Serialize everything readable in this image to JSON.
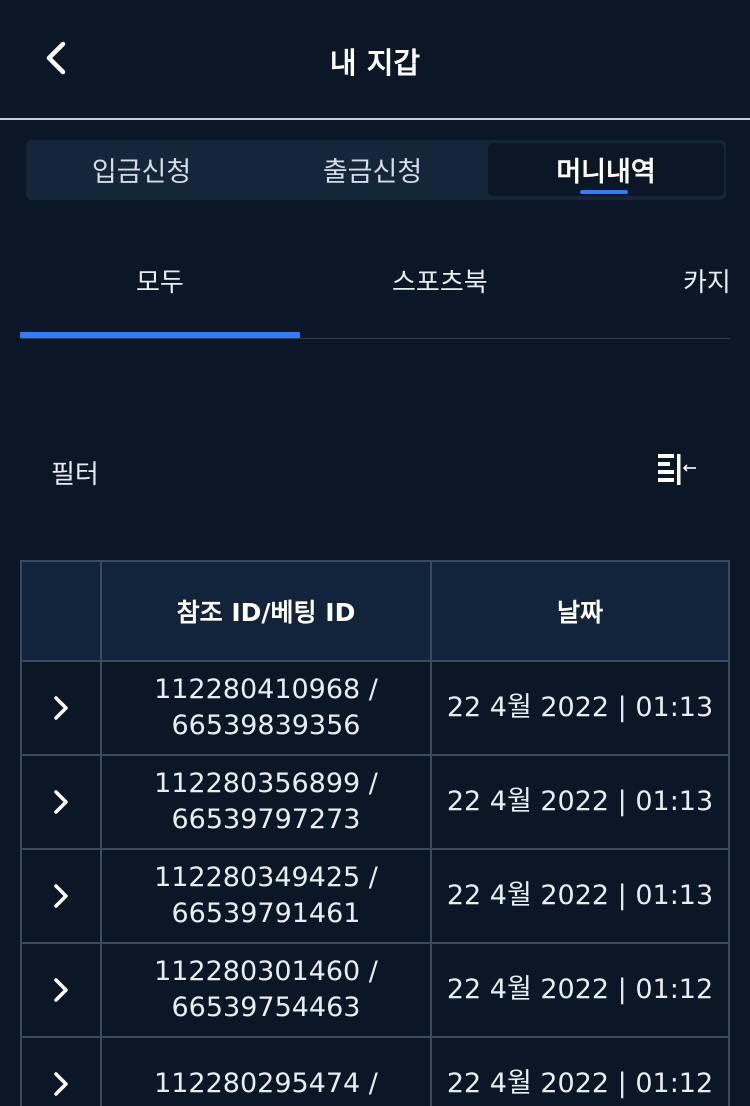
{
  "header": {
    "title": "내 지갑",
    "back_icon": "chevron-left-icon"
  },
  "segments": [
    {
      "label": "입금신청",
      "active": false
    },
    {
      "label": "출금신청",
      "active": false
    },
    {
      "label": "머니내역",
      "active": true
    }
  ],
  "categories": [
    {
      "label": "모두",
      "active": true
    },
    {
      "label": "스포츠북",
      "active": false
    },
    {
      "label": "카지",
      "active": false
    }
  ],
  "filter": {
    "label": "필터",
    "icon": "filter-list-icon"
  },
  "table": {
    "headers": {
      "expand": "",
      "ref": "참조 ID/베팅 ID",
      "date": "날짜"
    },
    "rows": [
      {
        "ref_id": "112280410968 /",
        "bet_id": "66539839356",
        "date": "22 4월 2022 | 01:13"
      },
      {
        "ref_id": "112280356899 /",
        "bet_id": "66539797273",
        "date": "22 4월 2022 | 01:13"
      },
      {
        "ref_id": "112280349425 /",
        "bet_id": "66539791461",
        "date": "22 4월 2022 | 01:13"
      },
      {
        "ref_id": "112280301460 /",
        "bet_id": "66539754463",
        "date": "22 4월 2022 | 01:12"
      },
      {
        "ref_id": "112280295474 /",
        "bet_id": "",
        "date": "22 4월 2022 | 01:12"
      }
    ]
  },
  "colors": {
    "background": "#0b1727",
    "accent": "#2f7cf6",
    "header_row": "#12243c",
    "border": "#3b4a5e"
  }
}
